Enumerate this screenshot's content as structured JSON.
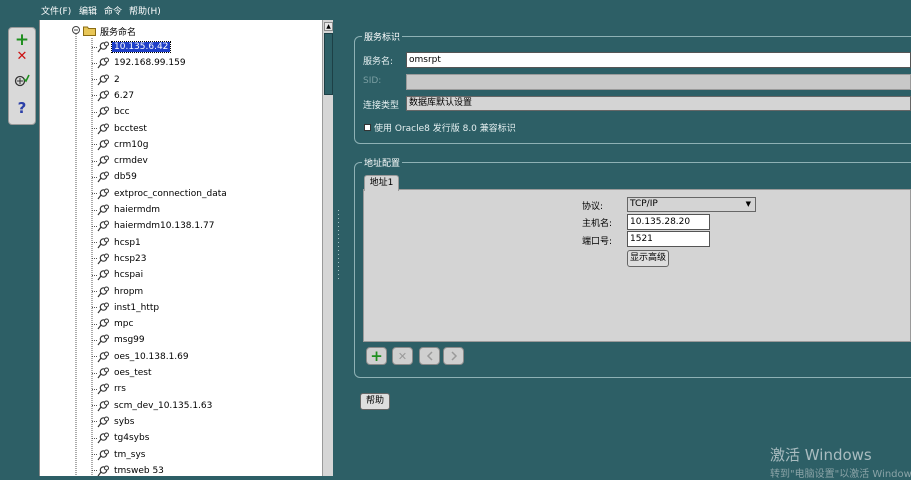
{
  "menu": {
    "file": "文件(F)",
    "edit": "编辑",
    "command": "命令",
    "help": "帮助(H)"
  },
  "toolbar": {
    "add_glyph": "+",
    "remove_glyph": "✕",
    "help_glyph": "?"
  },
  "tree": {
    "root_label": "服务命名",
    "items": [
      "10.135.6.42",
      "192.168.99.159",
      "2",
      "6.27",
      "bcc",
      "bcctest",
      "crm10g",
      "crmdev",
      "db59",
      "extproc_connection_data",
      "haiermdm",
      "haiermdm10.138.1.77",
      "hcsp1",
      "hcsp23",
      "hcspai",
      "hropm",
      "inst1_http",
      "mpc",
      "msg99",
      "oes_10.138.1.69",
      "oes_test",
      "rrs",
      "scm_dev_10.135.1.63",
      "sybs",
      "tg4sybs",
      "tm_sys",
      "tmsweb 53"
    ],
    "selected_index": 0
  },
  "service": {
    "group_title": "服务标识",
    "service_name_label": "服务名:",
    "service_name_value": "omsrpt",
    "sid_label": "SID:",
    "sid_value": "",
    "conn_type_label": "连接类型",
    "conn_type_value": "数据库默认设置",
    "oracle8_label": "使用 Oracle8 发行版 8.0 兼容标识"
  },
  "address": {
    "group_title": "地址配置",
    "tab_label": "地址1",
    "protocol_label": "协议:",
    "protocol_value": "TCP/IP",
    "host_label": "主机名:",
    "host_value": "10.135.28.20",
    "port_label": "端口号:",
    "port_value": "1521",
    "advanced_button": "显示高级"
  },
  "help_button": "帮助",
  "watermark": {
    "line1": "激活 Windows",
    "line2": "转到\"电脑设置\"以激活 Windows。"
  },
  "colors": {
    "background": "#2d5f66",
    "selection": "#1e3fc8",
    "add_green": "#1f8f1f",
    "remove_red": "#cc1111",
    "help_blue": "#2b3fa8"
  }
}
